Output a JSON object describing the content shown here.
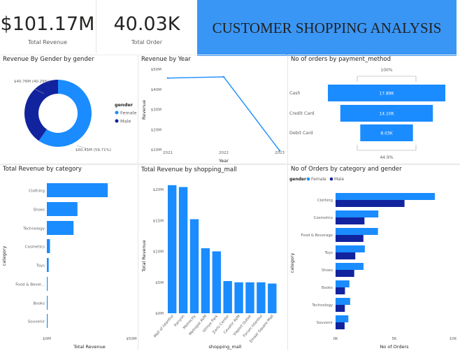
{
  "kpis": {
    "revenue_value": "$101.17M",
    "revenue_label": "Total Revenue",
    "orders_value": "40.03K",
    "orders_label": "Total Order"
  },
  "banner_title": "CUSTOMER SHOPPING ANALYSIS",
  "colors": {
    "primary": "#1a8cff",
    "female": "#1a8cff",
    "male": "#12239e",
    "banner": "#3a96f5"
  },
  "chart_data": [
    {
      "type": "pie",
      "title": "Revenue By Gender by gender",
      "legend_title": "gender",
      "legend_position": "right",
      "slices": [
        {
          "label": "Female",
          "value": 60.41,
          "pct": "59.71%",
          "data_label": "$60.41M (59.71%)"
        },
        {
          "label": "Male",
          "value": 40.76,
          "pct": "40.29%",
          "data_label": "$40.76M (40.29%)"
        }
      ]
    },
    {
      "type": "line",
      "title": "Revenue by Year",
      "xlabel": "Year",
      "ylabel": "Revenue",
      "x": [
        "2021",
        "2022",
        "2023"
      ],
      "values": [
        45.6,
        46.2,
        9.5
      ],
      "ylim": [
        10,
        50
      ],
      "yticks": [
        "$10M",
        "$20M",
        "$30M",
        "$40M",
        "$50M"
      ]
    },
    {
      "type": "bar",
      "title": "No of orders by payment_method",
      "categories": [
        "Cash",
        "Credit Card",
        "Debit Card"
      ],
      "values": [
        17890,
        14100,
        8030
      ],
      "data_labels": [
        "17.89K",
        "14.10K",
        "8.03K"
      ],
      "top_pct": "100%",
      "bottom_pct": "44.9%"
    },
    {
      "type": "bar",
      "title": "Total Revenue by category",
      "xlabel": "Total Revenue",
      "ylabel": "category",
      "categories": [
        "Clothing",
        "Shoes",
        "Technology",
        "Cosmetics",
        "Toys",
        "Food & Bever...",
        "Books",
        "Souvenir"
      ],
      "values": [
        36.0,
        18.1,
        15.8,
        1.85,
        1.1,
        0.23,
        0.23,
        0.17
      ],
      "xticks": [
        "$0M",
        "$50M"
      ],
      "xlim": [
        0,
        50
      ]
    },
    {
      "type": "bar",
      "title": "Total Revenue by shopping_mall",
      "xlabel": "shopping_mall",
      "ylabel": "Total Revenue",
      "categories": [
        "Mall of Istanbul",
        "Kanyon",
        "Metrocity",
        "Metropol AVM",
        "Istinye Park",
        "Zorlu Center",
        "Cevahir AVM",
        "Viaport Outlet",
        "Forum Istanbul",
        "Emaar Square Mall"
      ],
      "values": [
        20.7,
        20.4,
        15.2,
        10.5,
        10.0,
        5.2,
        5.0,
        5.0,
        5.0,
        4.8
      ],
      "yticks": [
        "$0M",
        "$5M",
        "$10M",
        "$15M",
        "$20M"
      ],
      "ylim": [
        0,
        20
      ]
    },
    {
      "type": "bar",
      "title": "No of Orders by category and gender",
      "legend_title": "gender",
      "legend_position": "top-left",
      "xlabel": "No of Orders",
      "ylabel": "category",
      "categories": [
        "Clothing",
        "Cosmetics",
        "Food & Beverage",
        "Toys",
        "Shoes",
        "Books",
        "Technology",
        "Souvenir"
      ],
      "series": [
        {
          "name": "Female",
          "values": [
            8450,
            3640,
            3610,
            2490,
            2380,
            1180,
            1240,
            1090
          ]
        },
        {
          "name": "Male",
          "values": [
            5870,
            2460,
            2370,
            1680,
            1590,
            800,
            790,
            770
          ]
        }
      ],
      "xticks": [
        "0K",
        "5K",
        "10K"
      ],
      "xlim": [
        0,
        10000
      ]
    }
  ]
}
